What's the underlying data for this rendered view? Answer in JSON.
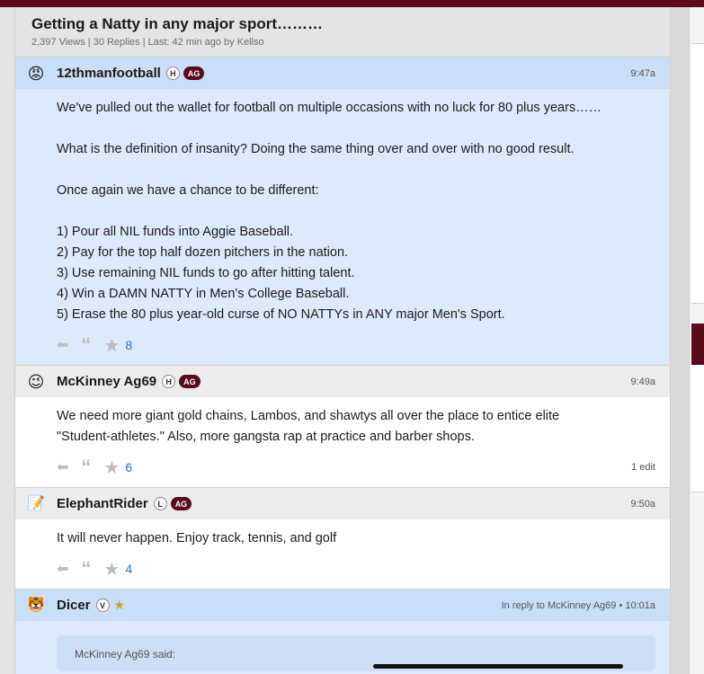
{
  "thread": {
    "title": "Getting a Natty in any major sport………",
    "meta": "2,397 Views | 30 Replies | Last: 42 min ago by Kellso"
  },
  "posts": [
    {
      "avatar_icon": "angry-face-icon",
      "username": "12thmanfootball",
      "badge": "H",
      "tag": "AG",
      "time": "9:47a",
      "lines": [
        "We've pulled out the wallet for football on multiple occasions with no luck for 80 plus years……",
        "",
        "What is the definition of insanity? Doing the same thing over and over with no good result.",
        "",
        "Once again we have a chance to be different:",
        "",
        "1) Pour all NIL funds into Aggie Baseball.",
        "2) Pay for the top half dozen pitchers in the nation.",
        "3) Use remaining NIL funds to go after hitting talent.",
        "4) Win a DAMN NATTY in Men's College Baseball.",
        "5) Erase the 80 plus year-old curse of NO NATTYs in ANY major Men's Sport."
      ],
      "likes": "8"
    },
    {
      "avatar_icon": "wink-face-icon",
      "username": "McKinney Ag69",
      "badge": "H",
      "tag": "AG",
      "time": "9:49a",
      "lines": [
        "We need more giant gold chains, Lambos, and shawtys all over the place to entice elite",
        "\"Student-athletes.\" Also, more gangsta rap at practice and barber shops."
      ],
      "likes": "6",
      "edit_note": "1 edit"
    },
    {
      "avatar_icon": "notepad-icon",
      "username": "ElephantRider",
      "badge": "L",
      "tag": "AG",
      "time": "9:50a",
      "lines": [
        "It will never happen. Enjoy track, tennis, and golf"
      ],
      "likes": "4"
    },
    {
      "avatar_icon": "tiger-icon",
      "username": "Dicer",
      "badge": "V",
      "reply_info": "In reply to McKinney Ag69 • 10:01a",
      "quote_header": "McKinney Ag69 said:"
    }
  ],
  "icons": {
    "reply": "reply-arrow-icon",
    "quote": "quote-icon",
    "star": "star-icon"
  },
  "colors": {
    "brand_maroon": "#5b0a1c",
    "highlight_bg": "#dbeafc",
    "link_blue": "#2f6fb3"
  }
}
